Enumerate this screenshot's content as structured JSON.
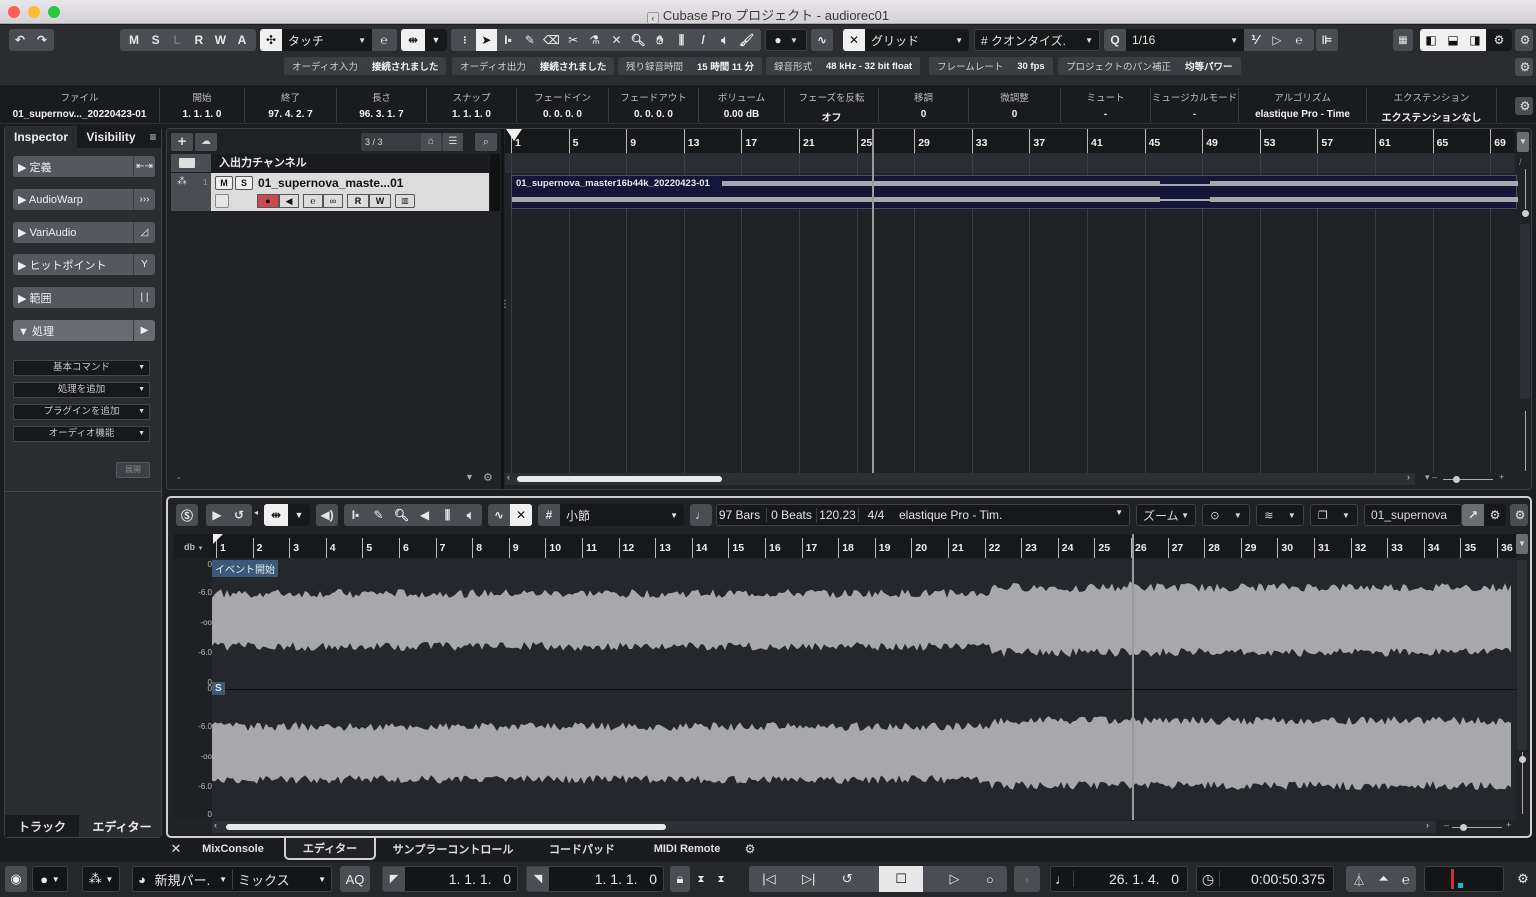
{
  "window": {
    "title": "Cubase Pro プロジェクト - audiorec01"
  },
  "toolbar": {
    "undo_icon": "undo-icon",
    "redo_icon": "redo-icon",
    "state_buttons": [
      "M",
      "S",
      "L",
      "R",
      "W",
      "A"
    ],
    "automation_mode": "タッチ",
    "snap_type": "グリッド",
    "quantize_type": "クオンタイズ.",
    "quantize_value": "1/16"
  },
  "status_strip": [
    {
      "label": "オーディオ入力",
      "value": "接続されました"
    },
    {
      "label": "オーディオ出力",
      "value": "接続されました"
    },
    {
      "label": "残り録音時間",
      "value": "15 時間 11 分"
    },
    {
      "label": "録音形式",
      "value": "48 kHz - 32 bit float"
    },
    {
      "label": "フレームレート",
      "value": "30 fps"
    },
    {
      "label": "プロジェクトのパン補正",
      "value": "均等パワー"
    }
  ],
  "infoline": [
    {
      "label": "ファイル",
      "value": "01_supernov..._20220423-01"
    },
    {
      "label": "開始",
      "value": "1. 1. 1.   0"
    },
    {
      "label": "終了",
      "value": "97. 4. 2.   7"
    },
    {
      "label": "長さ",
      "value": "96. 3. 1.   7"
    },
    {
      "label": "スナップ",
      "value": "1. 1. 1.   0"
    },
    {
      "label": "フェードイン",
      "value": "0. 0. 0.   0"
    },
    {
      "label": "フェードアウト",
      "value": "0. 0. 0.   0"
    },
    {
      "label": "ボリューム",
      "value": "0.00        dB"
    },
    {
      "label": "フェーズを反転",
      "value": "オフ"
    },
    {
      "label": "移調",
      "value": "0"
    },
    {
      "label": "微調整",
      "value": "0"
    },
    {
      "label": "ミュート",
      "value": "-"
    },
    {
      "label": "ミュージカルモード",
      "value": "-"
    },
    {
      "label": "アルゴリズム",
      "value": "elastique Pro - Time"
    },
    {
      "label": "エクステンション",
      "value": "エクステンションなし"
    }
  ],
  "inspector": {
    "tabs": [
      "Inspector",
      "Visibility"
    ],
    "sections": [
      {
        "label": "▶ 定義",
        "icon": "⇤⇥"
      },
      {
        "label": "▶ AudioWarp",
        "icon": "›››"
      },
      {
        "label": "▶ VariAudio",
        "icon": "◿"
      },
      {
        "label": "▶ ヒットポイント",
        "icon": "Y"
      },
      {
        "label": "▶ 範囲",
        "icon": "| |"
      },
      {
        "label": "▼ 処理",
        "icon": "▶"
      }
    ],
    "dropdowns": [
      "基本コマンド",
      "処理を追加",
      "プラグインを追加",
      "オーディオ機能"
    ],
    "expand_button": "展開"
  },
  "tracklist": {
    "count": "3 / 3",
    "folder_track": "入出力チャンネル",
    "audio_track": {
      "number": "1",
      "name": "01_supernova_maste...01",
      "mute": "M",
      "solo": "S",
      "read": "R",
      "write": "W"
    },
    "event_name": "01_supernova_master16b44k_20220423-01"
  },
  "project_ruler": [
    "1",
    "5",
    "9",
    "13",
    "17",
    "21",
    "25",
    "29",
    "33",
    "37",
    "41",
    "45",
    "49",
    "53",
    "57",
    "61",
    "65",
    "69"
  ],
  "editor": {
    "snap_type": "小節",
    "length_bars": "97 Bars",
    "length_beats": "0 Beats",
    "tempo": "120.23",
    "signature": "4/4",
    "algorithm": "elastique Pro - Tim.",
    "zoom": "ズーム",
    "event_name": "01_supernova",
    "db_label": "db",
    "event_start_label": "イベント開始",
    "sync_marker": "S",
    "ruler": [
      "1",
      "2",
      "3",
      "4",
      "5",
      "6",
      "7",
      "8",
      "9",
      "10",
      "11",
      "12",
      "13",
      "14",
      "15",
      "16",
      "17",
      "18",
      "19",
      "20",
      "21",
      "22",
      "23",
      "24",
      "25",
      "26",
      "27",
      "28",
      "29",
      "30",
      "31",
      "32",
      "33",
      "34",
      "35",
      "36"
    ],
    "db_scale": [
      "0",
      "-6.0",
      "-oo",
      "-6.0",
      "0",
      "0",
      "-6.0",
      "-oo",
      "-6.0",
      "0"
    ]
  },
  "left_bottom_tabs": [
    "トラック",
    "エディター"
  ],
  "zone_tabs": [
    "MixConsole",
    "エディター",
    "サンプラーコントロール",
    "コードパッド",
    "MIDI Remote"
  ],
  "transport": {
    "preset": "新規パー.",
    "mix": "ミックス",
    "aq": "AQ",
    "left_locator": "1. 1. 1.   0",
    "right_locator": "1. 1. 1.   0",
    "position_bars": "26. 1. 4.   0",
    "position_time": "0:00:50.375"
  },
  "colors": {
    "accent_red": "#c8323a",
    "record_red": "#d0454e",
    "event_bg": "#141538",
    "waveform": "#a8a8aa",
    "cyan": "#1fb5d0"
  }
}
